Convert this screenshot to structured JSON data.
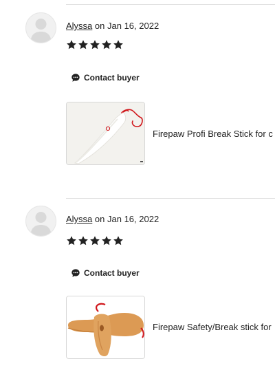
{
  "reviews": [
    {
      "reviewer": "Alyssa",
      "date_text": "on Jan 16, 2022",
      "rating": 5,
      "contact_label": "Contact buyer",
      "product_title": "Firepaw Profi Break Stick for c",
      "product_image": "white-break-stick-with-red-cord"
    },
    {
      "reviewer": "Alyssa",
      "date_text": "on Jan 16, 2022",
      "rating": 5,
      "contact_label": "Contact buyer",
      "product_title": "Firepaw Safety/Break stick for",
      "product_image": "wooden-break-stick-with-red-cord"
    }
  ],
  "icons": {
    "avatar": "default-avatar-icon",
    "star": "star-icon",
    "contact": "chat-bubble-icon"
  },
  "colors": {
    "star": "#222222",
    "cord": "#d0161b",
    "wood": "#d9954e"
  }
}
